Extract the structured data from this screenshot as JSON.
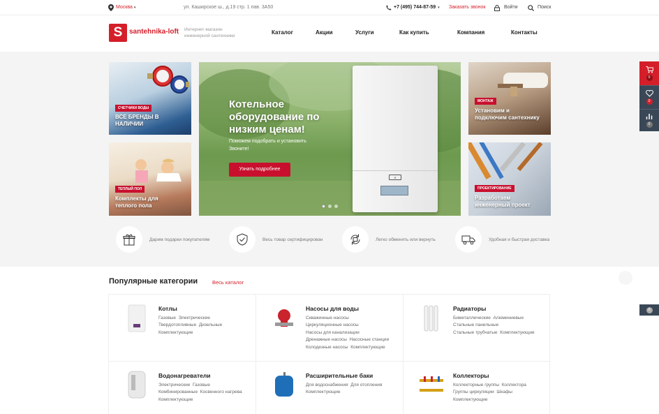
{
  "topbar": {
    "city": "Москва",
    "address": "ул. Каширское ш., д.19 стр. 1 пав. 3А50",
    "phone": "+7 (495) 744-87-59",
    "callback": "Заказать звонок",
    "login": "Войти",
    "search": "Поиск"
  },
  "header": {
    "logo_letter": "S",
    "logo_text": "santehnika-loft",
    "tagline": "Интернет-магазин инженерной сантехники",
    "nav": [
      "Каталог",
      "Акции",
      "Услуги",
      "Как купить",
      "Компания",
      "Контакты"
    ]
  },
  "tiles": [
    {
      "tag": "Счетчики воды",
      "caption": "ВСЕ БРЕНДЫ В НАЛИЧИИ"
    },
    {
      "tag": "Теплый пол",
      "caption": "Комплекты для теплого пола"
    },
    {
      "tag": "Монтаж",
      "caption": "Установим и подключим сантехнику"
    },
    {
      "tag": "Проектирование",
      "caption": "Разработаем инженерный проект"
    }
  ],
  "hero": {
    "title": "Котельное оборудование по низким ценам!",
    "subtitle": "Поможем подобрать и установить Звоните!",
    "button": "Узнать подробнее"
  },
  "features": [
    "Дарим подарки покупателям",
    "Весь товар сертифицирован",
    "Легко обменять или вернуть",
    "Удобная и быстрая доставка"
  ],
  "sidebar": {
    "cart_count": "0",
    "fav_count": "0",
    "compare_count": "0",
    "float_count": "0"
  },
  "section": {
    "title": "Популярные категории",
    "link": "Весь каталог"
  },
  "categories": [
    {
      "title": "Котлы",
      "links": [
        "Газовые",
        "Электрические",
        "Твердотопливные",
        "Дизельные",
        "Комплектующие"
      ]
    },
    {
      "title": "Насосы для воды",
      "links": [
        "Скважинные насосы",
        "Циркуляционные насосы",
        "Насосы для канализации",
        "Дренажные насосы",
        "Насосные станции",
        "Колодезные насосы",
        "Комплектующие"
      ]
    },
    {
      "title": "Радиаторы",
      "links": [
        "Биметаллические",
        "Алюминиевые",
        "Стальные панельные",
        "Стальные трубчатые",
        "Комплектующие"
      ]
    },
    {
      "title": "Водонагреватели",
      "links": [
        "Электрические",
        "Газовые",
        "Комбинированные",
        "Косвенного нагрева",
        "Комплектующие"
      ]
    },
    {
      "title": "Расширительные баки",
      "links": [
        "Для водоснабжения",
        "Для отопления",
        "Комплектующие"
      ]
    },
    {
      "title": "Коллекторы",
      "links": [
        "Коллекторные группы",
        "Коллектора",
        "Группы циркуляции",
        "Шкафы",
        "Комплектующие"
      ]
    }
  ]
}
